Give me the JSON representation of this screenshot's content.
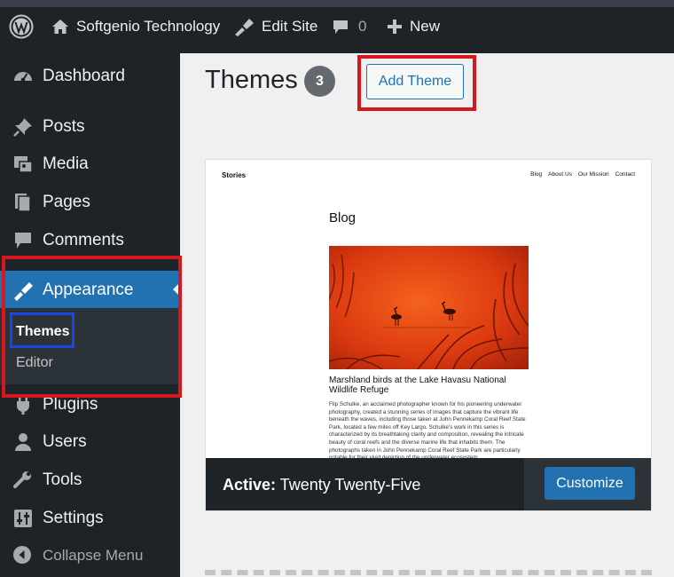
{
  "admin_bar": {
    "site_name": "Softgenio Technology",
    "edit_site": "Edit Site",
    "comments_count": "0",
    "new_label": "New"
  },
  "sidebar": {
    "items": [
      {
        "label": "Dashboard",
        "icon": "dashboard-icon"
      },
      {
        "label": "Posts",
        "icon": "pin-icon"
      },
      {
        "label": "Media",
        "icon": "media-icon"
      },
      {
        "label": "Pages",
        "icon": "pages-icon"
      },
      {
        "label": "Comments",
        "icon": "comment-icon"
      },
      {
        "label": "Appearance",
        "icon": "brush-icon",
        "active": true
      },
      {
        "label": "Plugins",
        "icon": "plug-icon"
      },
      {
        "label": "Users",
        "icon": "user-icon"
      },
      {
        "label": "Tools",
        "icon": "wrench-icon"
      },
      {
        "label": "Settings",
        "icon": "settings-icon"
      }
    ],
    "submenu": [
      {
        "label": "Themes",
        "current": true
      },
      {
        "label": "Editor"
      }
    ],
    "collapse_label": "Collapse Menu"
  },
  "main": {
    "title": "Themes",
    "count": "3",
    "add_button": "Add Theme"
  },
  "theme_card": {
    "screenshot": {
      "site_title": "Stories",
      "nav": [
        "Blog",
        "About Us",
        "Our Mission",
        "Contact"
      ],
      "heading": "Blog",
      "post_title": "Marshland birds at the Lake Havasu National Wildlife Refuge",
      "post_excerpt": "Flip Schulke, an acclaimed photographer known for his pioneering underwater photography, created a stunning series of images that capture the vibrant life beneath the waves, including those taken at John Pennekamp Coral Reef State Park, located a few miles off Key Largo. Schulke's work in this series is characterized by its breathtaking clarity and composition, revealing the intricate beauty of coral reefs and the diverse marine life that inhabits them. The photographs taken in John Pennekamp Coral Reef State Park are particularly notable for their vivid depiction of the underwater ecosystem."
    },
    "active_label": "Active:",
    "theme_name": "Twenty Twenty-Five",
    "customize_label": "Customize"
  },
  "colors": {
    "admin_dark": "#1d2327",
    "accent_blue": "#2271b1",
    "highlight_red": "#d6181e",
    "highlight_blue": "#1546e8",
    "background": "#f0f0f1"
  }
}
